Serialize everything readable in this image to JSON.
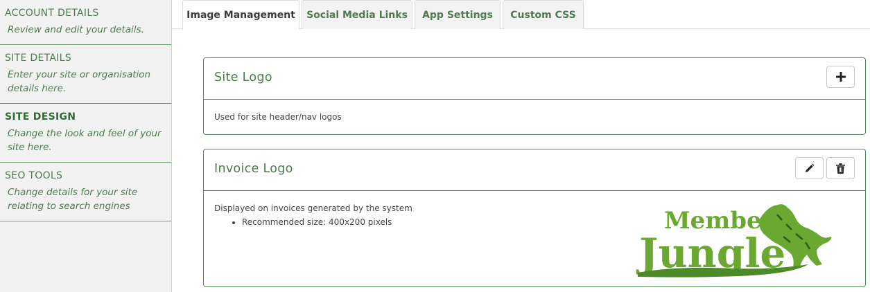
{
  "sidebar": {
    "items": [
      {
        "title": "ACCOUNT DETAILS",
        "desc": "Review and edit your details."
      },
      {
        "title": "SITE DETAILS",
        "desc": "Enter your site or organisation details here."
      },
      {
        "title": "SITE DESIGN",
        "desc": "Change the look and feel of your site here."
      },
      {
        "title": "SEO TOOLS",
        "desc": "Change details for your site relating to search engines"
      }
    ],
    "active_index": 2
  },
  "tabs": [
    {
      "label": "Image Management",
      "active": true
    },
    {
      "label": "Social Media Links",
      "active": false
    },
    {
      "label": "App Settings",
      "active": false
    },
    {
      "label": "Custom CSS",
      "active": false
    }
  ],
  "panels": {
    "site_logo": {
      "title": "Site Logo",
      "description": "Used for site header/nav logos",
      "actions": [
        "plus-icon"
      ]
    },
    "invoice_logo": {
      "title": "Invoice Logo",
      "description": "Displayed on invoices generated by the system",
      "bullets": [
        "Recommended size: 400x200 pixels"
      ],
      "actions": [
        "pencil-icon",
        "trash-icon"
      ],
      "logo": {
        "line1": "Member",
        "line2": "Jungle"
      }
    }
  },
  "colors": {
    "accent": "#4e7a50",
    "panel_border": "#4e8a55",
    "logo_green": "#6aa832"
  }
}
